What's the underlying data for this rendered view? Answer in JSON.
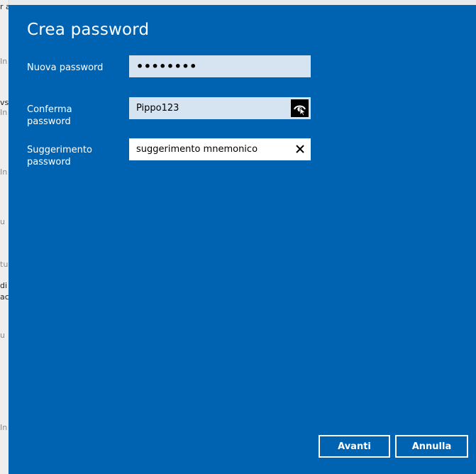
{
  "background_window": {
    "fragments": [
      "r a",
      "In",
      "vs",
      "In",
      "In",
      "u",
      "tu",
      "di",
      "ac",
      "u",
      "In"
    ]
  },
  "dialog": {
    "title": "Crea password",
    "fields": [
      {
        "label": "Nuova password",
        "value": "••••••••",
        "masked": true
      },
      {
        "label": "Conferma password",
        "value": "Pippo123",
        "masked": false,
        "action_icon": "reveal-password-icon"
      },
      {
        "label": "Suggerimento password",
        "value": "suggerimento mnemonico",
        "masked": false,
        "action_icon": "clear-icon"
      }
    ],
    "buttons": {
      "next": "Avanti",
      "cancel": "Annulla"
    }
  },
  "colors": {
    "dialog_bg": "#0063b1",
    "field_bg": "#d6e4f2",
    "field_focused_bg": "#ffffff",
    "text_light": "#ffffff"
  }
}
